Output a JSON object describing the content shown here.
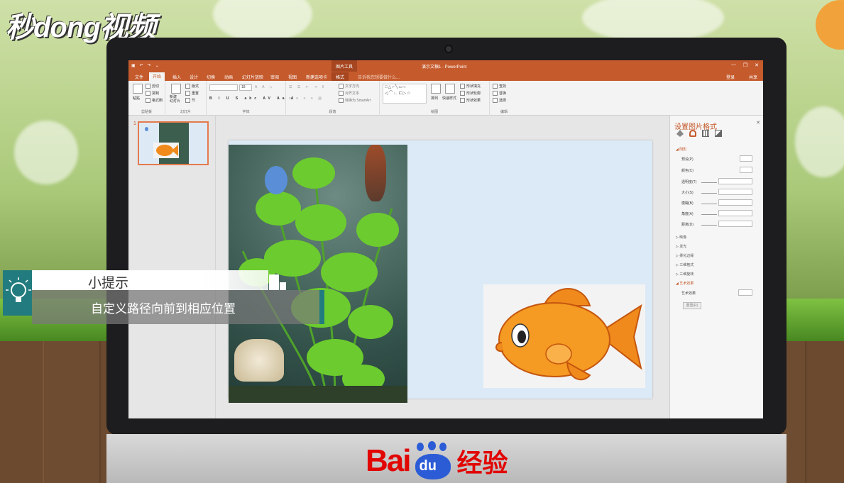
{
  "watermark": {
    "logo_text": "秒dong视频"
  },
  "monitor": {
    "brand": {
      "text_1": "Bai",
      "paw_text": "du",
      "text_2": "经验",
      "color": "#e10602",
      "paw_color": "#2b5cd6"
    }
  },
  "app": {
    "accent_color": "#c55a2c",
    "title": "演示文稿1 - PowerPoint",
    "context_tab_group": "图片工具",
    "quick_access": [
      "save-icon",
      "undo-icon",
      "redo-icon",
      "customize-icon"
    ],
    "window_buttons": {
      "minimize": "—",
      "restore": "❐",
      "close": "✕"
    },
    "tabs": [
      {
        "label": "文件",
        "active": false
      },
      {
        "label": "开始",
        "active": true
      },
      {
        "label": "插入",
        "active": false
      },
      {
        "label": "设计",
        "active": false
      },
      {
        "label": "切换",
        "active": false
      },
      {
        "label": "动画",
        "active": false
      },
      {
        "label": "幻灯片放映",
        "active": false
      },
      {
        "label": "审阅",
        "active": false
      },
      {
        "label": "视图",
        "active": false
      },
      {
        "label": "新建选项卡",
        "active": false
      },
      {
        "label": "格式",
        "active": false
      }
    ],
    "tell_me": "告诉我您想要做什么...",
    "login": "登录",
    "share": "共享"
  },
  "ribbon": {
    "clipboard": {
      "label": "剪贴板",
      "paste": "粘贴",
      "cut": "剪切",
      "copy": "复制",
      "format_painter": "格式刷"
    },
    "slides": {
      "label": "幻灯片",
      "new_slide": "新建\n幻灯片",
      "layout": "版式",
      "reset": "重置",
      "section": "节"
    },
    "font": {
      "label": "字体",
      "size": "18"
    },
    "paragraph": {
      "label": "段落",
      "text_direction": "文字方向",
      "align_text": "对齐文本",
      "convert_smartart": "转换为 SmartArt"
    },
    "drawing": {
      "label": "绘图",
      "arrange": "排列",
      "quick_styles": "快速样式",
      "shape_fill": "形状填充",
      "shape_outline": "形状轮廓",
      "shape_effects": "形状效果"
    },
    "editing": {
      "label": "编辑",
      "find": "查找",
      "replace": "替换",
      "select": "选择"
    }
  },
  "thumbnails": [
    {
      "number": "1"
    }
  ],
  "format_pane": {
    "title": "设置图片格式",
    "close": "✕",
    "tab_icons": [
      "fill-line-icon",
      "effects-icon",
      "size-properties-icon",
      "picture-icon"
    ],
    "shadow_section": {
      "label": "阴影",
      "rows": [
        {
          "label": "预设(P)",
          "type": "dropdown"
        },
        {
          "label": "颜色(C)",
          "type": "dropdown"
        },
        {
          "label": "透明度(T)",
          "type": "slider"
        },
        {
          "label": "大小(S)",
          "type": "slider"
        },
        {
          "label": "模糊(B)",
          "type": "slider"
        },
        {
          "label": "角度(A)",
          "type": "slider"
        },
        {
          "label": "距离(D)",
          "type": "slider"
        }
      ]
    },
    "collapsed_sections": [
      "映像",
      "发光",
      "柔化边缘",
      "三维格式",
      "三维旋转"
    ],
    "art_section": {
      "label": "艺术效果",
      "row_label": "艺术效果",
      "reset": "重置(R)"
    }
  },
  "tip": {
    "title": "小提示",
    "body": "自定义路径向前到相应位置",
    "accent_color": "#227c7f"
  }
}
